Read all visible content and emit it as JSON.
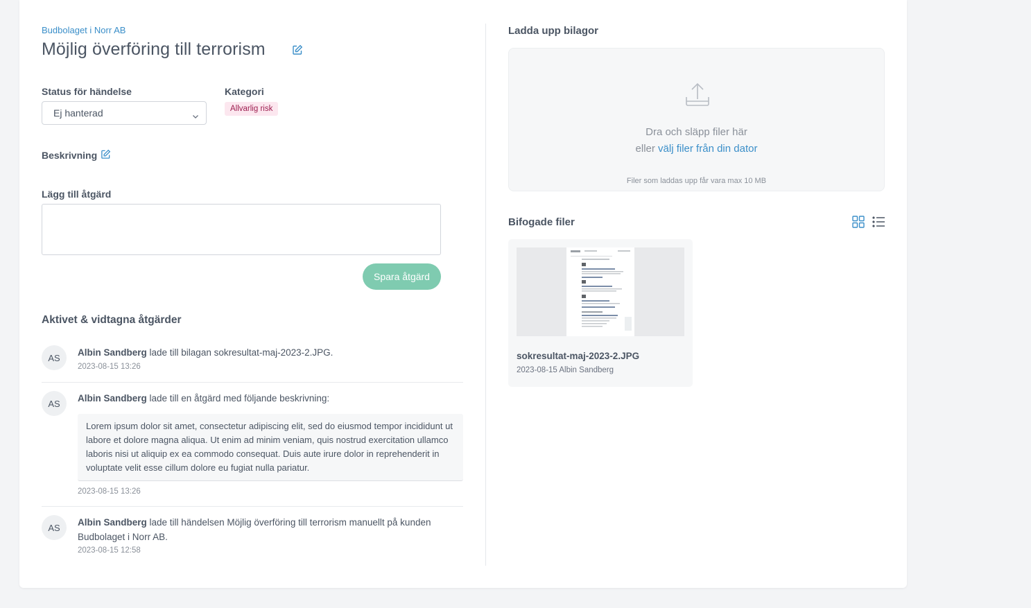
{
  "header": {
    "breadcrumb": "Budbolaget i Norr AB",
    "title": "Möjlig överföring till terrorism"
  },
  "status": {
    "label": "Status för händelse",
    "selected": "Ej hanterad"
  },
  "category": {
    "label": "Kategori",
    "badge": "Allvarlig risk",
    "badge_color": "#fce7ef"
  },
  "description": {
    "label": "Beskrivning"
  },
  "action": {
    "label": "Lägg till åtgärd",
    "value": "",
    "save_label": "Spara åtgärd",
    "save_color": "#7fcbb0"
  },
  "activity": {
    "title": "Aktivet & vidtagna åtgärder",
    "items": [
      {
        "initials": "AS",
        "user": "Albin Sandberg",
        "text": " lade till bilagan sokresultat-maj-2023-2.JPG.",
        "time": "2023-08-15 13:26"
      },
      {
        "initials": "AS",
        "user": "Albin Sandberg",
        "text": " lade till en åtgärd med följande beskrivning:",
        "quote": "Lorem ipsum dolor sit amet, consectetur adipiscing elit, sed do eiusmod tempor incididunt ut labore et dolore magna aliqua. Ut enim ad minim veniam, quis nostrud exercitation ullamco laboris nisi ut aliquip ex ea commodo consequat. Duis aute irure dolor in reprehenderit in voluptate velit esse cillum dolore eu fugiat nulla pariatur.",
        "time": "2023-08-15 13:26"
      },
      {
        "initials": "AS",
        "user": "Albin Sandberg",
        "text": " lade till händelsen Möjlig överföring till terrorism manuellt på kunden Budbolaget i Norr AB.",
        "time": "2023-08-15 12:58"
      }
    ]
  },
  "upload": {
    "title": "Ladda upp bilagor",
    "drop_text": "Dra och släpp filer här",
    "or_text": "eller ",
    "link_text": "välj filer från din dator",
    "note": "Filer som laddas upp får vara max 10 MB"
  },
  "attachments": {
    "title": "Bifogade filer",
    "view_grid_icon": "grid-view-icon",
    "view_list_icon": "list-view-icon",
    "accent": "#3b8fc9",
    "files": [
      {
        "name": "sokresultat-maj-2023-2.JPG",
        "meta": "2023-08-15 Albin Sandberg"
      }
    ]
  }
}
